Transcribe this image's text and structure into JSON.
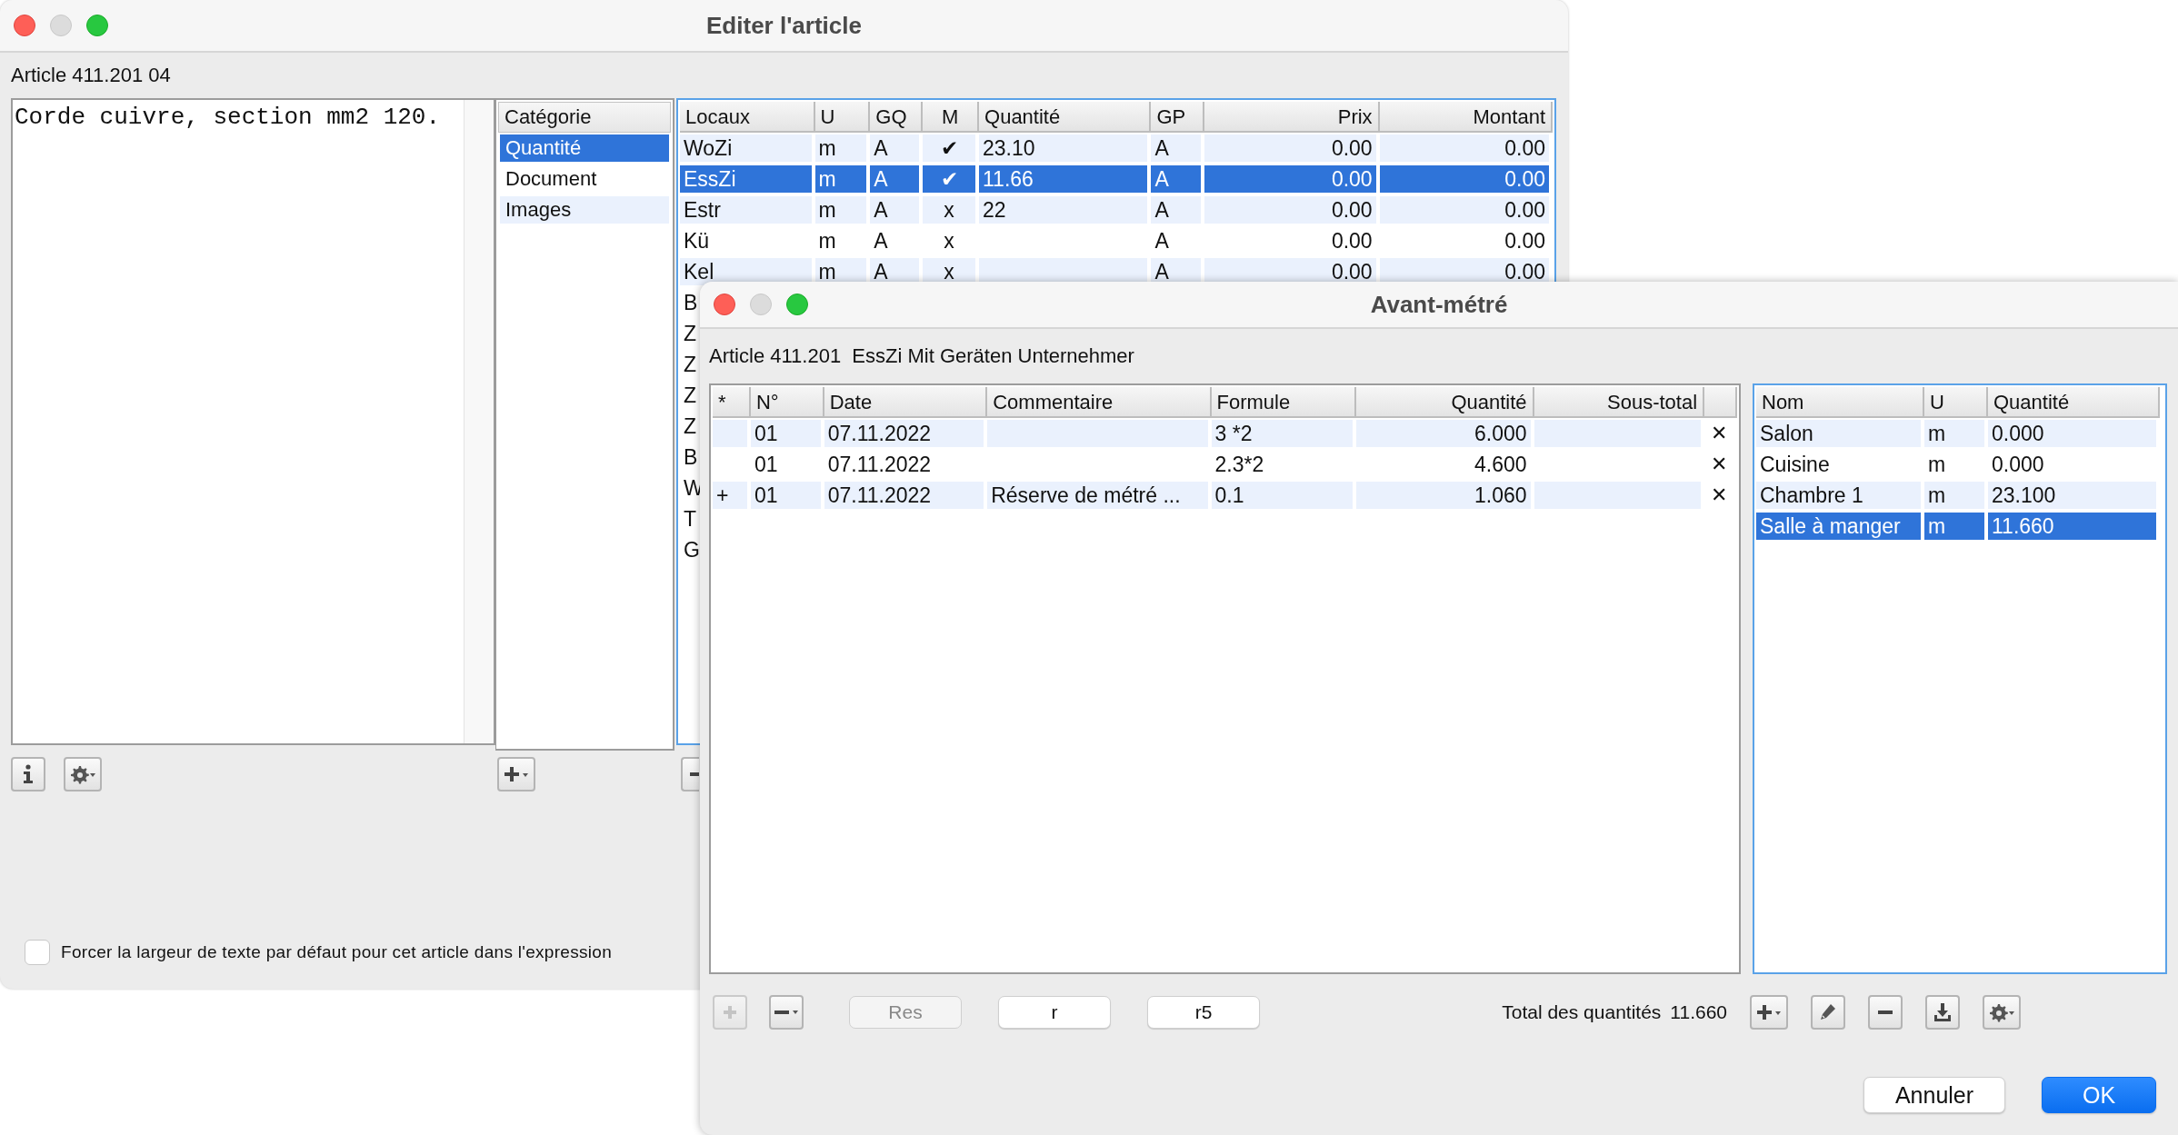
{
  "editor_window": {
    "title": "Editer l'article",
    "article_label": "Article 411.201 04",
    "description": "Corde cuivre, section mm2 120.",
    "category_list": {
      "header": "Catégorie",
      "items": [
        {
          "label": "Quantité",
          "selected": true
        },
        {
          "label": "Document",
          "selected": false
        },
        {
          "label": "Images",
          "selected": false
        }
      ]
    },
    "rooms_table": {
      "columns": [
        "Locaux",
        "U",
        "GQ",
        "M",
        "Quantité",
        "GP",
        "Prix",
        "Montant"
      ],
      "rows": [
        {
          "cells": [
            "WoZi",
            "m",
            "A",
            "✔",
            "23.10",
            "A",
            "0.00",
            "0.00"
          ],
          "selected": false
        },
        {
          "cells": [
            "EssZi",
            "m",
            "A",
            "✔",
            "11.66",
            "A",
            "0.00",
            "0.00"
          ],
          "selected": true
        },
        {
          "cells": [
            "Estr",
            "m",
            "A",
            "x",
            "22",
            "A",
            "0.00",
            "0.00"
          ],
          "selected": false
        },
        {
          "cells": [
            "Kü",
            "m",
            "A",
            "x",
            "",
            "A",
            "0.00",
            "0.00"
          ],
          "selected": false
        },
        {
          "cells": [
            "Kel",
            "m",
            "A",
            "x",
            "",
            "A",
            "0.00",
            "0.00"
          ],
          "selected": false
        },
        {
          "cells": [
            "B"
          ],
          "selected": false
        },
        {
          "cells": [
            "Z"
          ],
          "selected": false
        },
        {
          "cells": [
            "Z"
          ],
          "selected": false
        },
        {
          "cells": [
            "Z"
          ],
          "selected": false
        },
        {
          "cells": [
            "Z"
          ],
          "selected": false
        },
        {
          "cells": [
            "B"
          ],
          "selected": false
        },
        {
          "cells": [
            "W"
          ],
          "selected": false
        },
        {
          "cells": [
            "T"
          ],
          "selected": false
        },
        {
          "cells": [
            "G"
          ],
          "selected": false
        }
      ]
    },
    "force_width": {
      "label": "Forcer la largeur de texte par défaut pour cet article dans l'expression",
      "checked": false
    }
  },
  "metre_window": {
    "title": "Avant-métré",
    "article_label": "Article 411.201  EssZi Mit Geräten Unternehmer",
    "entries_table": {
      "columns": [
        "*",
        "N°",
        "Date",
        "Commentaire",
        "Formule",
        "Quantité",
        "Sous-total"
      ],
      "rows": [
        {
          "no": "01",
          "date": "07.11.2022",
          "formula": "3 *2",
          "quantity": "6.000",
          "delete": "✕"
        },
        {
          "no": "01",
          "date": "07.11.2022",
          "formula": "2.3*2",
          "quantity": "4.600",
          "delete": "✕"
        },
        {
          "marker": "+",
          "no": "01",
          "date": "07.11.2022",
          "comment": "Réserve de métré ...",
          "formula": "0.1",
          "quantity": "1.060",
          "delete": "✕"
        }
      ]
    },
    "rooms_table": {
      "columns": [
        "Nom",
        "U",
        "Quantité"
      ],
      "rows": [
        {
          "cells": [
            "Salon",
            "m",
            "0.000"
          ],
          "selected": false
        },
        {
          "cells": [
            "Cuisine",
            "m",
            "0.000"
          ],
          "selected": false
        },
        {
          "cells": [
            "Chambre 1",
            "m",
            "23.100"
          ],
          "selected": false
        },
        {
          "cells": [
            "Salle à manger",
            "m",
            "11.660"
          ],
          "selected": true
        }
      ]
    },
    "add_button": {
      "disabled": true
    },
    "text_buttons": [
      {
        "label": "Res",
        "disabled": true
      },
      {
        "label": "r",
        "disabled": false
      },
      {
        "label": "r5",
        "disabled": false
      }
    ],
    "total_label": "Total des quantités",
    "total_value": "11.660",
    "dialog_buttons": [
      {
        "label": "Annuler",
        "kind": "cancel"
      },
      {
        "label": "OK",
        "kind": "default"
      }
    ]
  }
}
